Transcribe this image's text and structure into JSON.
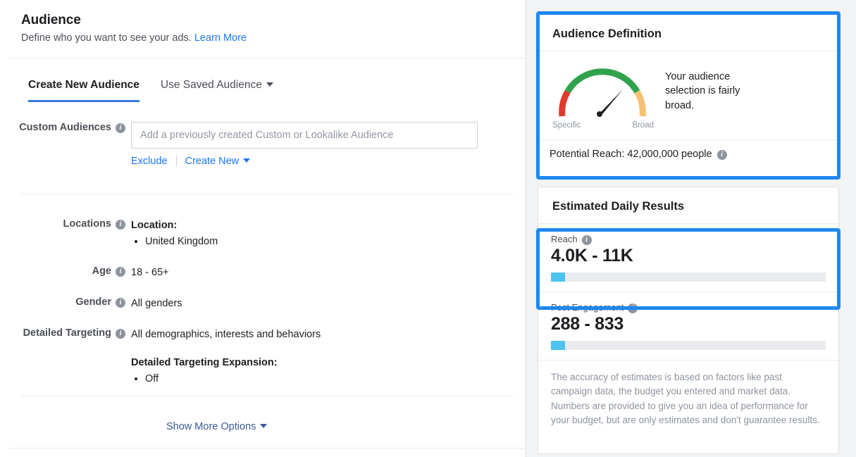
{
  "left": {
    "title": "Audience",
    "subtitle": "Define who you want to see your ads.",
    "learn_more": "Learn More",
    "tabs": [
      {
        "label": "Create New Audience",
        "active": true
      },
      {
        "label": "Use Saved Audience",
        "active": false
      }
    ],
    "custom_audiences": {
      "label": "Custom Audiences",
      "placeholder": "Add a previously created Custom or Lookalike Audience",
      "value": "",
      "exclude_label": "Exclude",
      "create_new_label": "Create New"
    },
    "locations": {
      "label": "Locations",
      "heading": "Location:",
      "items": [
        "United Kingdom"
      ]
    },
    "age": {
      "label": "Age",
      "value": "18 - 65+"
    },
    "gender": {
      "label": "Gender",
      "value": "All genders"
    },
    "detailed_targeting": {
      "label": "Detailed Targeting",
      "value": "All demographics, interests and behaviors",
      "expansion_heading": "Detailed Targeting Expansion:",
      "expansion_items": [
        "Off"
      ]
    },
    "show_more_options": "Show More Options"
  },
  "right": {
    "audience_definition": {
      "title": "Audience Definition",
      "gauge": {
        "min_label": "Specific",
        "max_label": "Broad",
        "needle_fraction": 0.62,
        "segments": [
          {
            "name": "specific",
            "color": "#e03a2f",
            "fraction": 0.12
          },
          {
            "name": "balanced",
            "color": "#31a24c",
            "fraction": 0.74
          },
          {
            "name": "broad",
            "color": "#f7c173",
            "fraction": 0.14
          }
        ]
      },
      "message": "Your audience selection is fairly broad.",
      "potential_reach": "Potential Reach: 42,000,000 people"
    },
    "estimated_daily_results": {
      "title": "Estimated Daily Results",
      "metrics": [
        {
          "label": "Reach",
          "value": "4.0K - 11K",
          "bar_percent": 5
        },
        {
          "label": "Post Engagement",
          "value": "288 - 833",
          "bar_percent": 5
        }
      ],
      "disclaimer": "The accuracy of estimates is based on factors like past campaign data, the budget you entered and market data. Numbers are provided to give you an idea of performance for your budget, but are only estimates and don't guarantee results."
    }
  },
  "highlights": {
    "accent_color": "#1e88f0"
  }
}
